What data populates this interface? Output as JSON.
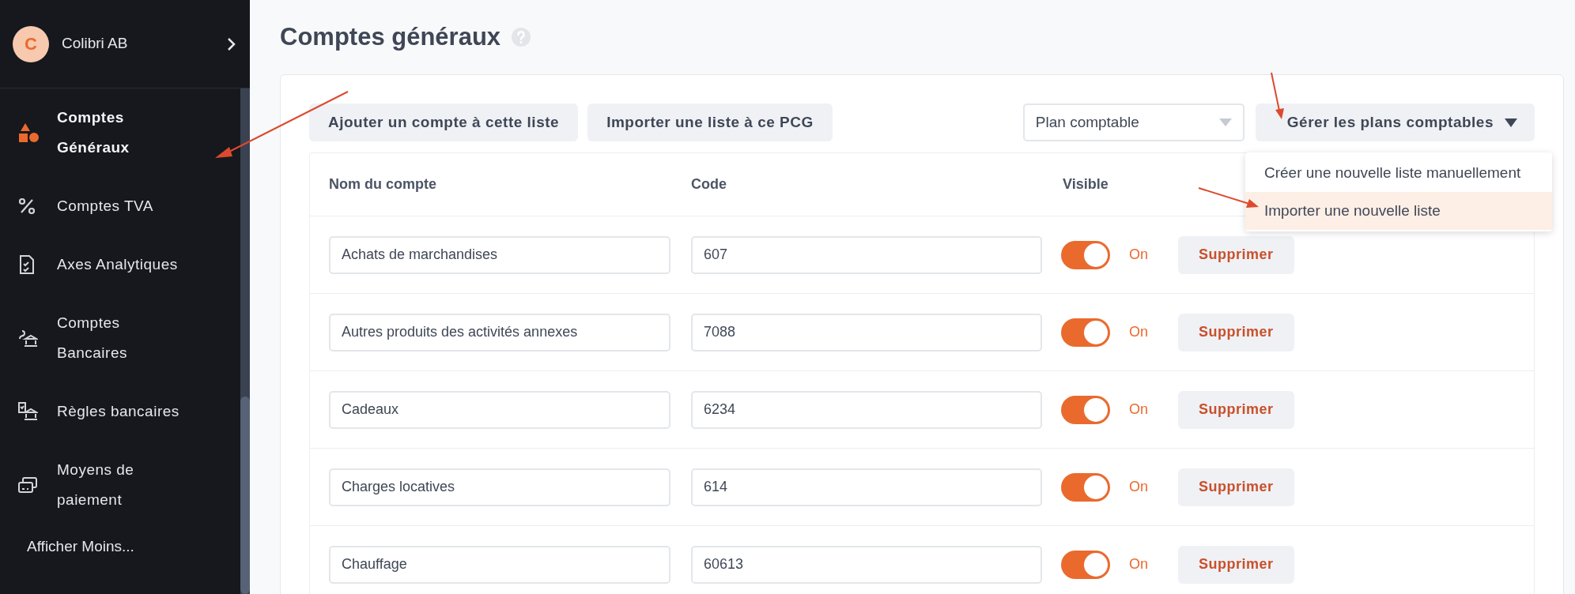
{
  "sidebar": {
    "company": {
      "initial": "C",
      "name": "Colibri AB"
    },
    "items": [
      {
        "kind": "shapes",
        "label": "Comptes Généraux",
        "selected": true
      },
      {
        "kind": "percent",
        "label": "Comptes TVA",
        "selected": false
      },
      {
        "kind": "document",
        "label": "Axes Analytiques",
        "selected": false
      },
      {
        "kind": "bank",
        "label": "Comptes Bancaires",
        "selected": false
      },
      {
        "kind": "rules",
        "label": "Règles bancaires",
        "selected": false
      },
      {
        "kind": "cards",
        "label": "Moyens de paiement",
        "selected": false
      }
    ],
    "show_less": "Afficher Moins..."
  },
  "page": {
    "title": "Comptes généraux"
  },
  "toolbar": {
    "buttons": [
      "Ajouter un compte à cette liste",
      "Importer une liste à ce PCG"
    ],
    "select": {
      "value": "Plan comptable"
    },
    "menu_button": "Gérer les plans comptables"
  },
  "menu": {
    "items": [
      {
        "label": "Créer une nouvelle liste manuellement",
        "selected": false
      },
      {
        "label": "Importer une nouvelle liste",
        "selected": true
      }
    ]
  },
  "table": {
    "columns": [
      "Nom du compte",
      "Code",
      "Visible"
    ],
    "rows": [
      {
        "name": "Achats de marchandises",
        "code": "607",
        "on": true,
        "state": "On",
        "action": "Supprimer"
      },
      {
        "name": "Autres produits des activités annexes",
        "code": "7088",
        "on": true,
        "state": "On",
        "action": "Supprimer"
      },
      {
        "name": "Cadeaux",
        "code": "6234",
        "on": true,
        "state": "On",
        "action": "Supprimer"
      },
      {
        "name": "Charges locatives",
        "code": "614",
        "on": true,
        "state": "On",
        "action": "Supprimer"
      },
      {
        "name": "Chauffage",
        "code": "60613",
        "on": true,
        "state": "On",
        "action": "Supprimer"
      }
    ]
  }
}
